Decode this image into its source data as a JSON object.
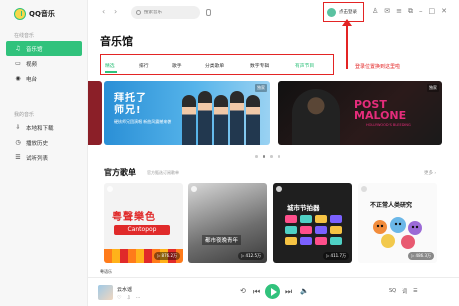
{
  "app": {
    "name": "QQ音乐"
  },
  "sidebar": {
    "groups": [
      {
        "label": "在线音乐",
        "items": [
          {
            "label": "音乐馆",
            "icon": "music-note-icon",
            "active": true
          },
          {
            "label": "视频",
            "icon": "video-icon",
            "active": false
          },
          {
            "label": "电台",
            "icon": "radio-icon",
            "active": false
          }
        ]
      },
      {
        "label": "我的音乐",
        "items": [
          {
            "label": "本地和下载",
            "icon": "download-icon",
            "active": false
          },
          {
            "label": "播放历史",
            "icon": "history-icon",
            "active": false
          },
          {
            "label": "试听列表",
            "icon": "playlist-icon",
            "active": false
          }
        ]
      }
    ]
  },
  "topbar": {
    "search_placeholder": "搜索音乐",
    "login_label": "点击登录",
    "icons": [
      "tshirt-icon",
      "mail-icon",
      "settings-icon",
      "minimize-mini-icon",
      "minimize-icon",
      "maximize-icon",
      "close-icon"
    ]
  },
  "annotation": {
    "text": "登录位置换到这里啦",
    "color": "#e32424"
  },
  "main": {
    "title": "音乐馆",
    "tabs": [
      {
        "label": "精选",
        "active": true
      },
      {
        "label": "排行",
        "active": false
      },
      {
        "label": "歌手",
        "active": false
      },
      {
        "label": "分类歌单",
        "active": false
      },
      {
        "label": "数字专辑",
        "active": false
      },
      {
        "label": "有声节目",
        "active": false
      }
    ]
  },
  "banners": [
    {
      "title_line1": "拜托了",
      "title_line2": "师兄!",
      "subtitle": "硬核师兄团演唱 新曲风震撼来袭",
      "tag": "独家"
    },
    {
      "title_line1": "POST",
      "title_line2": "MALONE",
      "subtitle": "HOLLYWOOD'S BLEEDING",
      "tag": "独家"
    }
  ],
  "carousel": {
    "count": 4,
    "active_index": 1
  },
  "playlists": {
    "title": "官方歌单",
    "subtitle": "官方甄选订阅歌单",
    "more_label": "更多",
    "cards": [
      {
        "art_line1": "粤聲樂色",
        "art_line2": "Cantopop",
        "plays": "▷ 876.2万",
        "caption": "粤语乐"
      },
      {
        "art_text": "都市夜晚青年",
        "plays": "▷ 412.5万",
        "caption": ""
      },
      {
        "art_text": "城市节拍器",
        "plays": "▷ 411.7万",
        "caption": ""
      },
      {
        "art_text": "不正常人类研究",
        "plays": "▷ 486.3万",
        "caption": ""
      }
    ]
  },
  "player": {
    "song": "云水谣",
    "song_icons": [
      "heart-icon",
      "download-icon",
      "more-icon"
    ],
    "controls": [
      "loop-icon",
      "prev-icon",
      "play-icon",
      "next-icon",
      "volume-icon"
    ],
    "right_controls": [
      "lyrics-label",
      "playlist-icon"
    ],
    "lyrics_label": "词",
    "quality_badge": "SQ"
  },
  "colors": {
    "accent": "#31c27c",
    "annotation": "#e32424"
  }
}
